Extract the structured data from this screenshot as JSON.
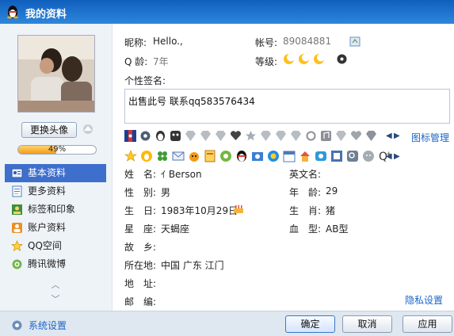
{
  "window": {
    "title": "我的资料"
  },
  "sidebar": {
    "change_avatar": "更换头像",
    "completion": 0.49,
    "completion_text": "49%",
    "items": [
      {
        "label": "基本资料",
        "icon": "contact-card-icon",
        "active": true
      },
      {
        "label": "更多资料",
        "icon": "document-icon",
        "active": false
      },
      {
        "label": "标签和印象",
        "icon": "profile-tag-icon",
        "active": false
      },
      {
        "label": "账户资料",
        "icon": "account-icon",
        "active": false
      },
      {
        "label": "QQ空间",
        "icon": "star-icon",
        "active": false
      },
      {
        "label": "腾讯微博",
        "icon": "weibo-icon",
        "active": false
      }
    ],
    "settings_label": "系统设置"
  },
  "profile": {
    "nickname_label": "昵称:",
    "nickname": "Hello.,",
    "account_label": "帐号:",
    "account": "89084881",
    "qage_label": "Q 龄:",
    "qage": "7年",
    "level_label": "等级:",
    "signature_label": "个性签名:",
    "signature": "出售此号 联系qq583576434",
    "badge_manage": "图标管理"
  },
  "details": {
    "name_label": "姓　名:",
    "name": "ｲ Berson",
    "english_name_label": "英文名:",
    "english_name": "",
    "gender_label": "性　别:",
    "gender": "男",
    "age_label": "年　龄:",
    "age": "29",
    "birthday_label": "生　日:",
    "birthday": "1983年10月29日",
    "zodiac_label": "生　肖:",
    "zodiac": "猪",
    "constellation_label": "星　座:",
    "constellation": "天蝎座",
    "blood_label": "血　型:",
    "blood": "AB型",
    "hometown_label": "故　乡:",
    "hometown": "",
    "location_label": "所在地:",
    "location": "中国  广东  江门",
    "address_label": "地　址:",
    "address": "",
    "zip_label": "邮　编:",
    "zip": "",
    "privacy": "隐私设置"
  },
  "buttons": {
    "ok": "确定",
    "cancel": "取消",
    "apply": "应用"
  },
  "colors": {
    "accent": "#3f6fcc",
    "title_blue": "#1e6fc9",
    "link": "#1b65c9",
    "progress": "#f39a1a"
  }
}
